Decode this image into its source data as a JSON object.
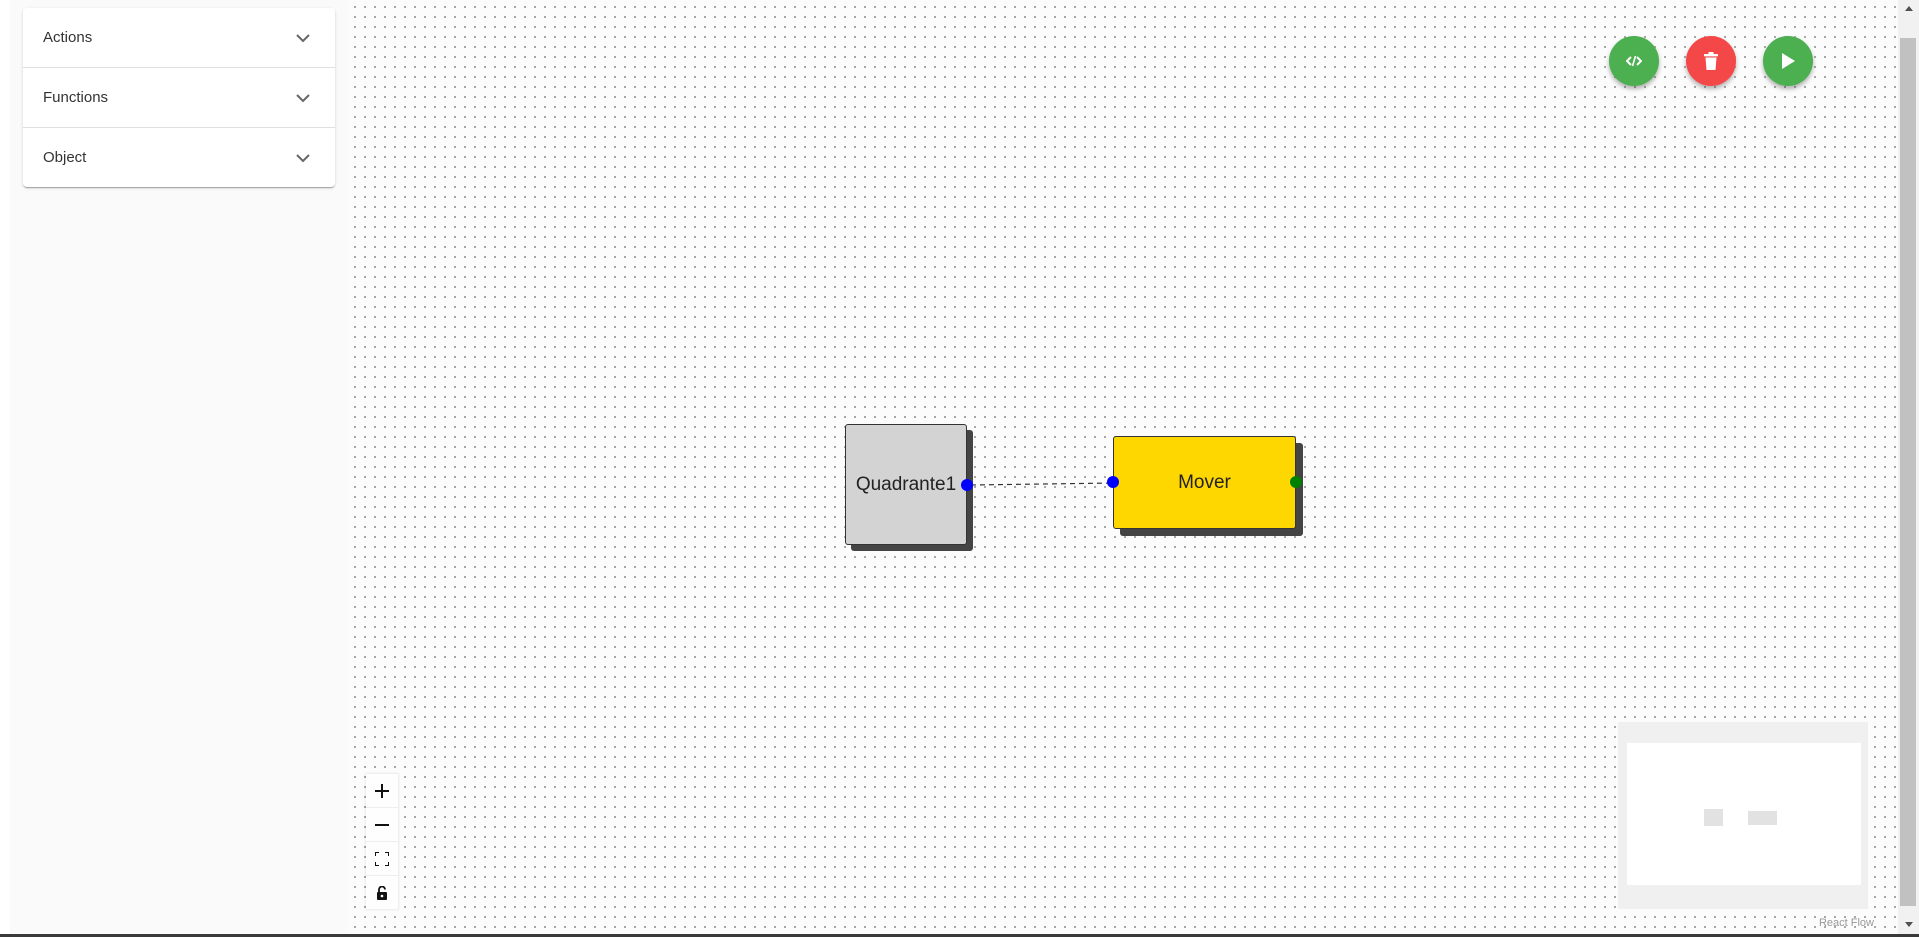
{
  "sidebar": {
    "sections": [
      {
        "label": "Actions"
      },
      {
        "label": "Functions"
      },
      {
        "label": "Object"
      }
    ]
  },
  "toolbar": {
    "code_icon": "code-icon",
    "delete_icon": "trash-icon",
    "run_icon": "play-icon",
    "colors": {
      "code": "#4caf50",
      "delete": "#f44747",
      "run": "#4caf50"
    }
  },
  "flow": {
    "nodes": [
      {
        "label": "Quadrante1",
        "color": "#d3d3d3"
      },
      {
        "label": "Mover",
        "color": "#ffd700"
      }
    ],
    "handle_colors": {
      "blue": "#0000ff",
      "green": "#008000"
    }
  },
  "controls": {
    "zoom_in_icon": "plus-icon",
    "zoom_out_icon": "minus-icon",
    "fit_view_icon": "fit-view-icon",
    "lock_icon": "lock-icon"
  },
  "attribution": "React Flow"
}
